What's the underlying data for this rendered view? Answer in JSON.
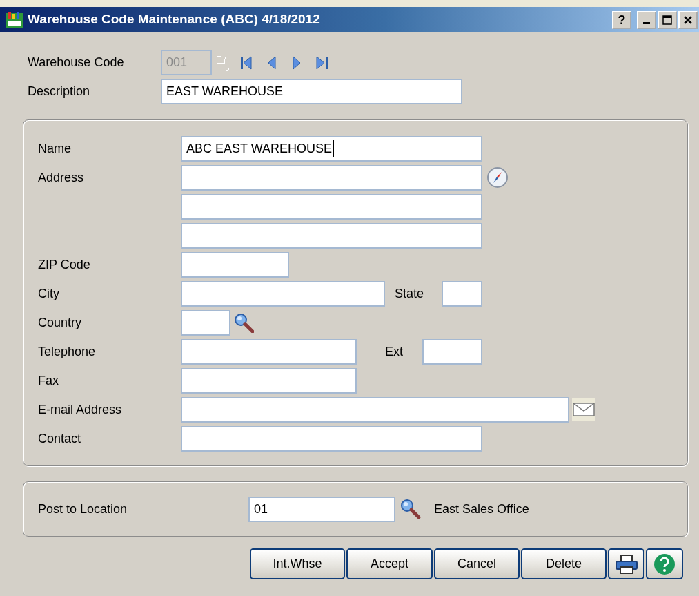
{
  "window": {
    "title": "Warehouse Code Maintenance (ABC) 4/18/2012",
    "controls": [
      {
        "kind": "help",
        "text": "?"
      },
      {
        "kind": "minimize"
      },
      {
        "kind": "maximize"
      },
      {
        "kind": "close"
      }
    ]
  },
  "header": {
    "warehouse_code": {
      "label": "Warehouse Code",
      "value": "001",
      "disabled": true
    },
    "description": {
      "label": "Description",
      "value": "EAST WAREHOUSE"
    }
  },
  "address_rows": [
    {
      "label": "Name",
      "items": [
        {
          "kind": "field",
          "value": "ABC EAST WAREHOUSE",
          "focused": true
        }
      ]
    },
    {
      "label": "Address",
      "items": [
        {
          "kind": "field"
        },
        {
          "kind": "map"
        }
      ]
    },
    {
      "items": [
        {
          "kind": "field"
        }
      ]
    },
    {
      "items": [
        {
          "kind": "field"
        }
      ]
    },
    {
      "label": "ZIP Code",
      "items": [
        {
          "kind": "field"
        }
      ]
    },
    {
      "label": "City",
      "items": [
        {
          "kind": "field"
        },
        {
          "kind": "label",
          "text": "State"
        },
        {
          "kind": "field"
        }
      ]
    },
    {
      "label": "Country",
      "items": [
        {
          "kind": "field"
        },
        {
          "kind": "lookup"
        }
      ]
    },
    {
      "label": "Telephone",
      "items": [
        {
          "kind": "field"
        },
        {
          "kind": "label",
          "text": "Ext"
        },
        {
          "kind": "field"
        }
      ]
    },
    {
      "label": "Fax",
      "items": [
        {
          "kind": "field"
        }
      ]
    },
    {
      "label": "E-mail Address",
      "items": [
        {
          "kind": "field"
        },
        {
          "kind": "email"
        }
      ]
    },
    {
      "label": "Contact",
      "items": [
        {
          "kind": "field"
        }
      ]
    }
  ],
  "post_to_location": {
    "label": "Post to Location",
    "value": "01",
    "description": "East Sales Office"
  },
  "buttons": [
    {
      "kind": "text",
      "label": "Int.Whse"
    },
    {
      "kind": "text",
      "label": "Accept"
    },
    {
      "kind": "text",
      "label": "Cancel"
    },
    {
      "kind": "text",
      "label": "Delete"
    },
    {
      "kind": "print"
    },
    {
      "kind": "help"
    }
  ]
}
